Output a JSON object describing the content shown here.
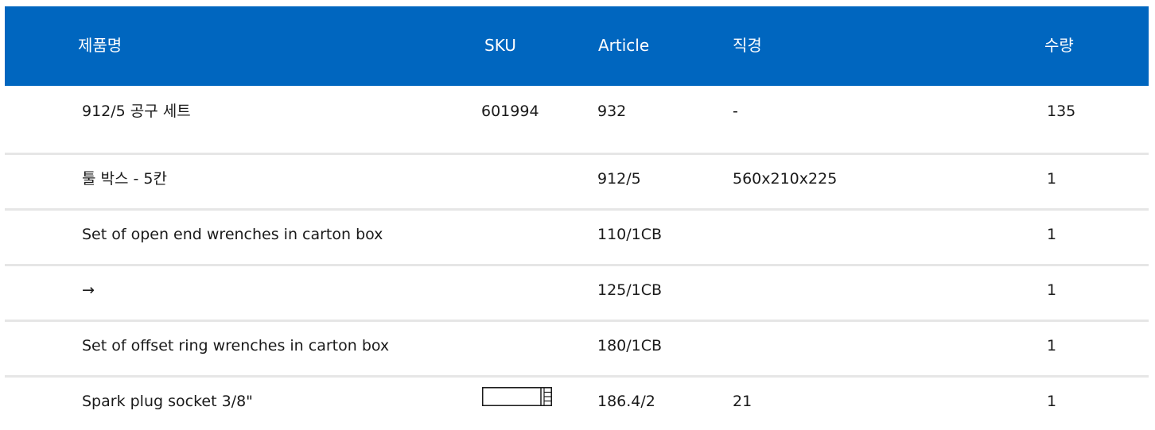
{
  "table": {
    "headers": {
      "name": "제품명",
      "sku": "SKU",
      "article": "Article",
      "diameter": "직경",
      "quantity": "수량"
    },
    "rows": [
      {
        "name": "912/5 공구 세트",
        "sku": "601994",
        "article": "932",
        "diameter": "-",
        "quantity": "135"
      },
      {
        "name": "툴 박스 - 5칸",
        "sku": "",
        "article": "912/5",
        "diameter": "560x210x225",
        "quantity": "1"
      },
      {
        "name": "Set of open end wrenches in carton box",
        "sku": "",
        "article": "110/1CB",
        "diameter": "",
        "quantity": "1"
      },
      {
        "name": "→",
        "sku": "",
        "article": "125/1CB",
        "diameter": "",
        "quantity": "1"
      },
      {
        "name": "Set of offset ring wrenches in carton box",
        "sku": "",
        "article": "180/1CB",
        "diameter": "",
        "quantity": "1"
      },
      {
        "name": "Spark plug socket 3/8\"",
        "sku_icon": "socket-icon",
        "article": "186.4/2",
        "diameter": "21",
        "quantity": "1"
      }
    ]
  },
  "colors": {
    "header_bg": "#0066bf",
    "header_text": "#ffffff",
    "row_divider": "#e6e6e6",
    "body_text": "#1a1a1a"
  }
}
